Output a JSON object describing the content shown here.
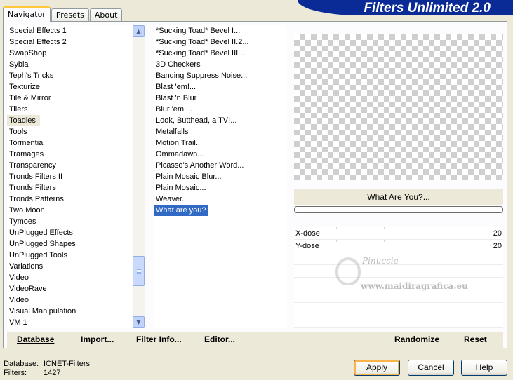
{
  "tabs": [
    "Navigator",
    "Presets",
    "About"
  ],
  "banner_title": "Filters Unlimited 2.0",
  "categories": [
    "Special Effects 1",
    "Special Effects 2",
    "SwapShop",
    "Sybia",
    "Teph's Tricks",
    "Texturize",
    "Tile & Mirror",
    "Tilers",
    "Toadies",
    "Tools",
    "Tormentia",
    "Tramages",
    "Transparency",
    "Tronds Filters II",
    "Tronds Filters",
    "Tronds Patterns",
    "Two Moon",
    "Tymoes",
    "UnPlugged Effects",
    "UnPlugged Shapes",
    "UnPlugged Tools",
    "Variations",
    "Video",
    "VideoRave",
    "Video",
    "Visual Manipulation",
    "VM 1"
  ],
  "selected_category": "Toadies",
  "filters": [
    "*Sucking Toad*  Bevel I...",
    "*Sucking Toad*  Bevel II.2...",
    "*Sucking Toad*  Bevel III...",
    "3D Checkers",
    "Banding Suppress Noise...",
    "Blast 'em!...",
    "Blast 'n Blur",
    "Blur 'em!...",
    "Look, Butthead, a TV!...",
    "Metalfalls",
    "Motion Trail...",
    "Ommadawn...",
    "Picasso's Another Word...",
    "Plain Mosaic Blur...",
    "Plain Mosaic...",
    "Weaver...",
    "What are you?"
  ],
  "selected_filter": "What are you?",
  "preview": {
    "filter_name": "What Are You?..."
  },
  "params": [
    {
      "label": "X-dose",
      "value": "20"
    },
    {
      "label": "Y-dose",
      "value": "20"
    }
  ],
  "watermark": {
    "name": "Pinuccia",
    "url": "www.maidiragrafica.eu"
  },
  "bottom_bar": {
    "database": "Database",
    "import": "Import...",
    "filter_info": "Filter Info...",
    "editor": "Editor...",
    "randomize": "Randomize",
    "reset": "Reset"
  },
  "info": {
    "database_label": "Database:",
    "database_value": "ICNET-Filters",
    "filters_label": "Filters:",
    "filters_value": "1427"
  },
  "buttons": {
    "apply": "Apply",
    "cancel": "Cancel",
    "help": "Help"
  },
  "scrollbar": {
    "up_icon": "▲",
    "down_icon": "▼",
    "position_fraction": 0.88
  }
}
